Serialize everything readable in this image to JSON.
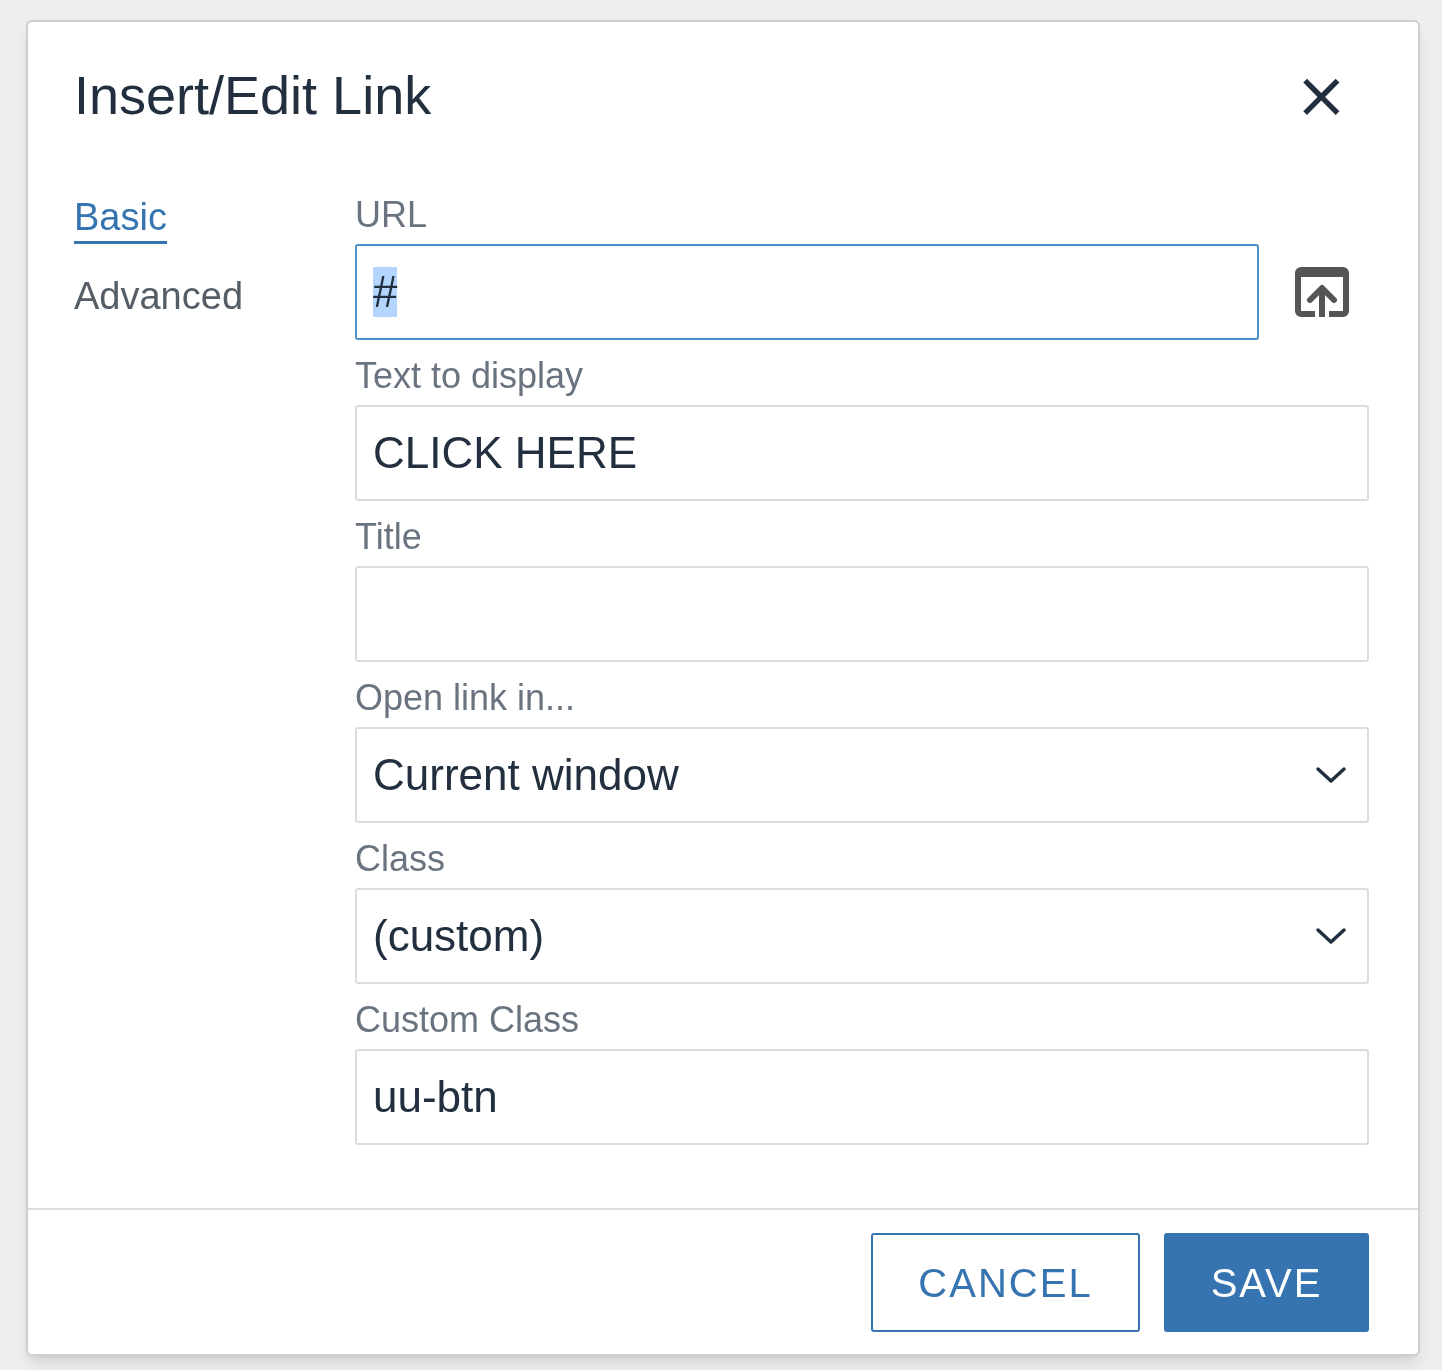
{
  "dialog": {
    "title": "Insert/Edit Link",
    "close": "×"
  },
  "tabs": [
    {
      "label": "Basic",
      "selected": true
    },
    {
      "label": "Advanced",
      "selected": false
    }
  ],
  "fields": [
    {
      "kind": "url",
      "label": "URL",
      "value": "#",
      "focused": true,
      "value_selected": true
    },
    {
      "kind": "text",
      "label": "Text to display",
      "value": "CLICK HERE",
      "focused": false
    },
    {
      "kind": "text",
      "label": "Title",
      "focused": false
    },
    {
      "kind": "select",
      "label": "Open link in...",
      "value": "Current window",
      "focused": false
    },
    {
      "kind": "select",
      "label": "Class",
      "value": "(custom)",
      "focused": false
    },
    {
      "kind": "text",
      "label": "Custom Class",
      "value": "uu-btn",
      "focused": false
    }
  ],
  "buttons": [
    {
      "kind": "secondary",
      "label": "CANCEL"
    },
    {
      "kind": "primary",
      "label": "SAVE"
    }
  ]
}
